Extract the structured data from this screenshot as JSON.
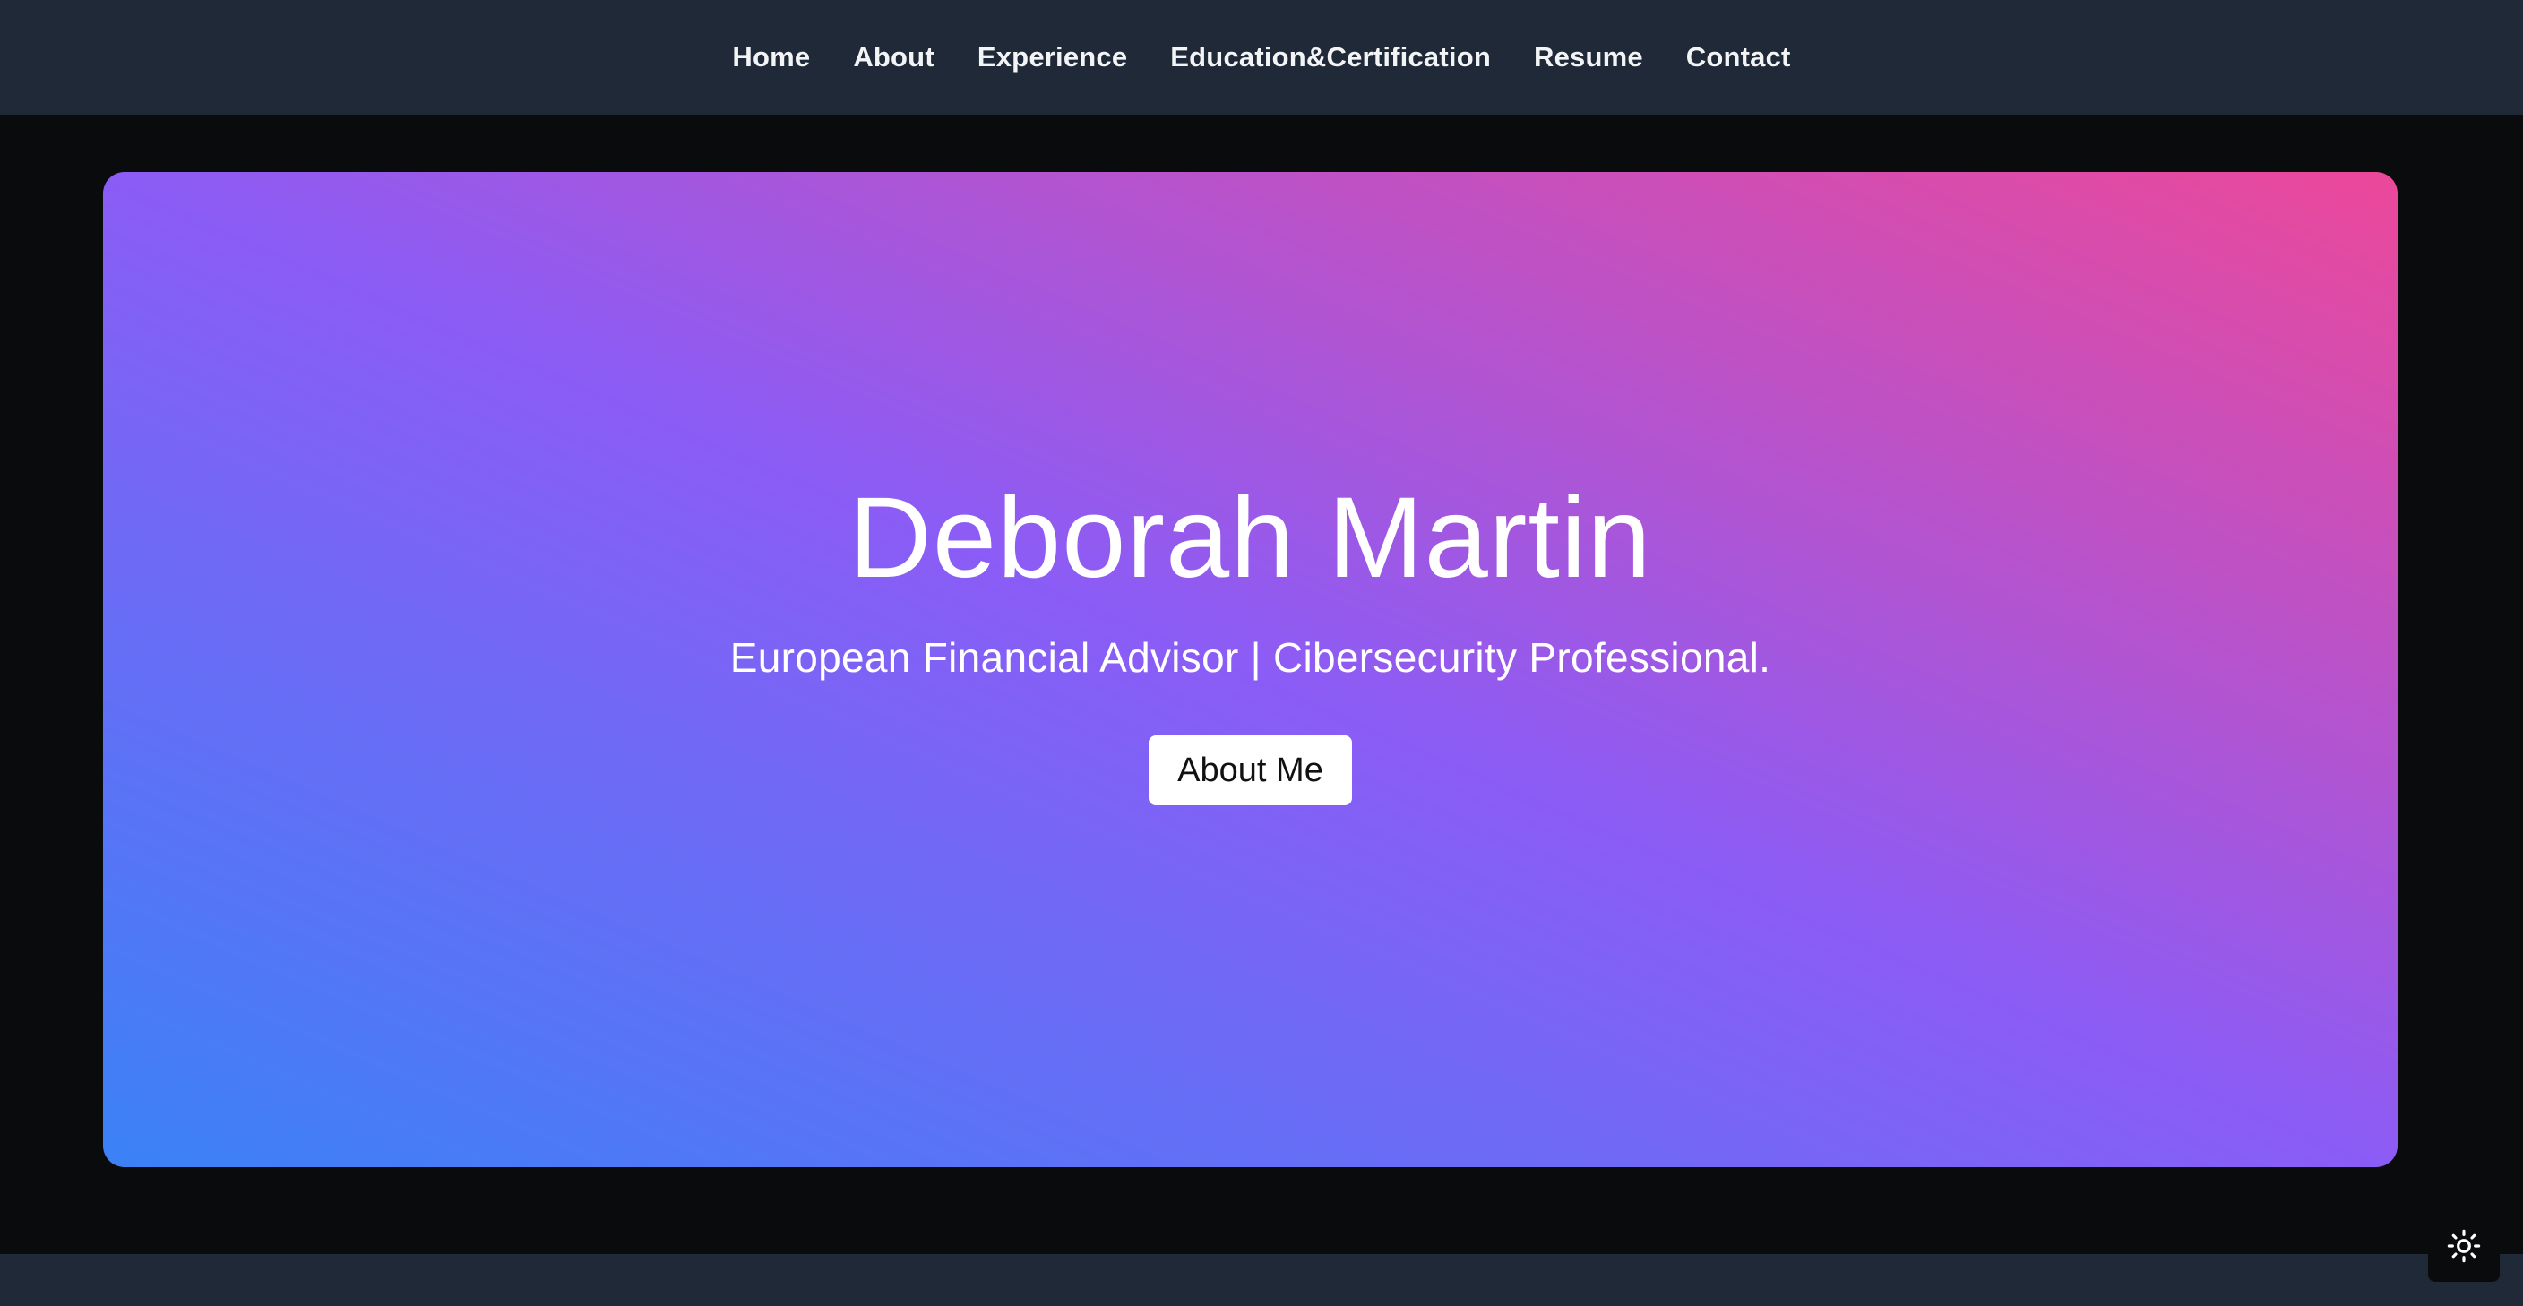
{
  "nav": {
    "items": [
      {
        "label": "Home"
      },
      {
        "label": "About"
      },
      {
        "label": "Experience"
      },
      {
        "label": "Education&Certification"
      },
      {
        "label": "Resume"
      },
      {
        "label": "Contact"
      }
    ]
  },
  "hero": {
    "title": "Deborah Martin",
    "subtitle": "European Financial Advisor | Cibersecurity Professional.",
    "button_label": "About Me"
  },
  "theme_toggle": {
    "icon": "sun-icon"
  },
  "colors": {
    "nav_bg": "#1f2937",
    "page_bg": "#0a0b0d",
    "gradient_start": "#3b82f6",
    "gradient_mid": "#8b5cf6",
    "gradient_end": "#ec4899"
  }
}
